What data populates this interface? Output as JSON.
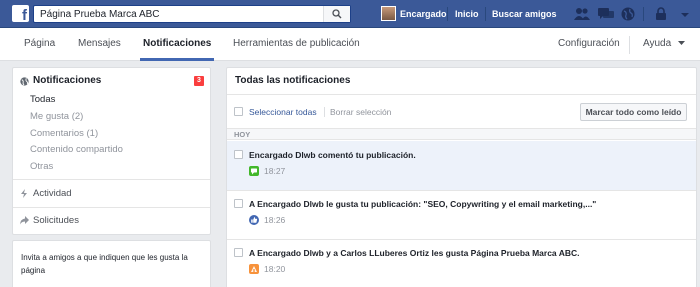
{
  "topbar": {
    "search_value": "Página Prueba Marca ABC",
    "user_name": "Encargado",
    "home_label": "Inicio",
    "find_friends_label": "Buscar amigos",
    "brand_color": "#3b5998"
  },
  "page_nav": {
    "tabs": [
      "Página",
      "Mensajes",
      "Notificaciones",
      "Herramientas de publicación"
    ],
    "active_tab": "Notificaciones",
    "settings_label": "Configuración",
    "help_label": "Ayuda"
  },
  "sidebar": {
    "title": "Notificaciones",
    "badge_count": "3",
    "items": [
      "Todas",
      "Me gusta (2)",
      "Comentarios (1)",
      "Contenido compartido",
      "Otras"
    ],
    "selected_item": "Todas",
    "sections": [
      "Actividad",
      "Solicitudes"
    ],
    "invite_text": "Invita a amigos a que indiquen que les gusta la página"
  },
  "main": {
    "title": "Todas las notificaciones",
    "select_all_label": "Seleccionar todas",
    "clear_selection_label": "Borrar selección",
    "mark_all_read_label": "Marcar todo como leído",
    "group_label": "HOY",
    "notifications": [
      {
        "text": "Encargado Dlwb comentó tu publicación.",
        "time": "18:27",
        "icon": "comment-icon",
        "icon_color": "#42b72a",
        "unread": true
      },
      {
        "text": "A Encargado Dlwb le gusta tu publicación: \"SEO, Copywriting y el email marketing,...\"",
        "time": "18:26",
        "icon": "like-icon",
        "icon_color": "#4267b2",
        "unread": false
      },
      {
        "text": "A Encargado Dlwb y a Carlos LLuberes Ortiz les gusta Página Prueba Marca ABC.",
        "time": "18:20",
        "icon": "page-like-icon",
        "icon_color": "#f7923b",
        "unread": false
      }
    ]
  }
}
